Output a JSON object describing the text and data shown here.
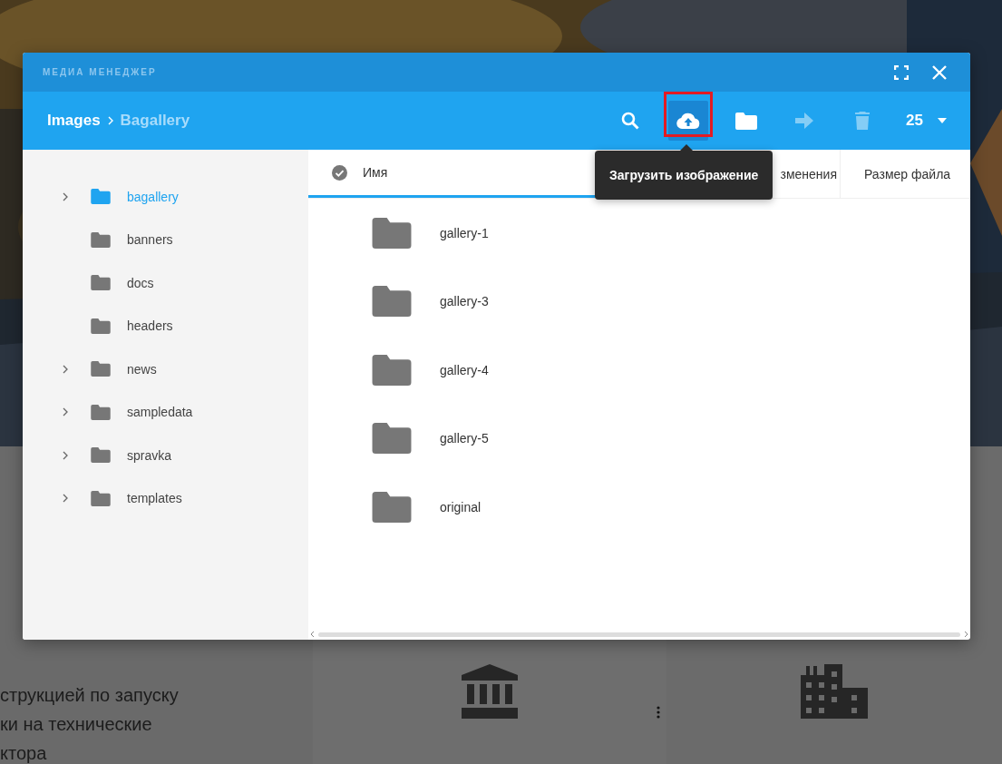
{
  "background": {
    "lines": [
      "струкцией по запуску",
      "ки на технические",
      "ктора"
    ]
  },
  "dialog": {
    "title": "МЕДИА МЕНЕДЖЕР",
    "breadcrumbs": [
      {
        "label": "Images",
        "selected": false
      },
      {
        "label": "Bagallery",
        "selected": true
      }
    ],
    "toolbar": [
      {
        "kind": "search",
        "disabled": false,
        "highlighted": false
      },
      {
        "kind": "upload",
        "disabled": false,
        "highlighted": true
      },
      {
        "kind": "folder",
        "disabled": false,
        "highlighted": false
      },
      {
        "kind": "move",
        "disabled": true,
        "highlighted": false
      },
      {
        "kind": "delete",
        "disabled": true,
        "highlighted": false
      }
    ],
    "page_size": "25",
    "tooltip": "Загрузить изображение",
    "tree": [
      {
        "label": "bagallery",
        "selected": true,
        "expandable": true
      },
      {
        "label": "banners",
        "selected": false,
        "expandable": false
      },
      {
        "label": "docs",
        "selected": false,
        "expandable": false
      },
      {
        "label": "headers",
        "selected": false,
        "expandable": false
      },
      {
        "label": "news",
        "selected": false,
        "expandable": true
      },
      {
        "label": "sampledata",
        "selected": false,
        "expandable": true
      },
      {
        "label": "spravka",
        "selected": false,
        "expandable": true
      },
      {
        "label": "templates",
        "selected": false,
        "expandable": true
      }
    ],
    "columns": [
      "Имя",
      "зменения",
      "Размер файла"
    ],
    "items": [
      {
        "name": "gallery-1"
      },
      {
        "name": "gallery-3"
      },
      {
        "name": "gallery-4"
      },
      {
        "name": "gallery-5"
      },
      {
        "name": "original"
      }
    ]
  }
}
